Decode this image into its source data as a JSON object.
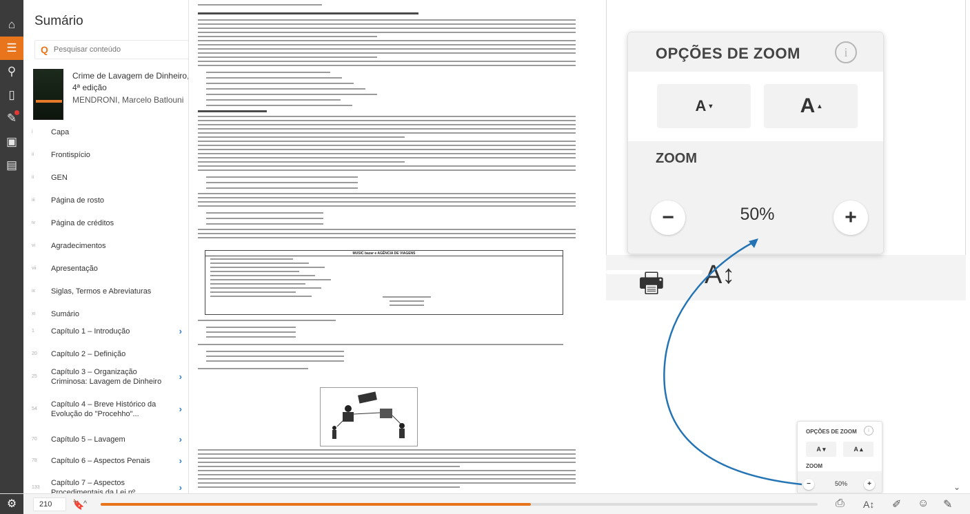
{
  "sidebar": {
    "title": "Sumário",
    "search_placeholder": "Pesquisar conteúdo",
    "book": {
      "title": "Crime de Lavagem de Dinheiro, 4ª edição",
      "author": "MENDRONI, Marcelo Batlouni"
    },
    "toc": [
      {
        "page": "i",
        "label": "Capa",
        "has_children": false
      },
      {
        "page": "ii",
        "label": "Frontispício",
        "has_children": false
      },
      {
        "page": "ii",
        "label": "GEN",
        "has_children": false
      },
      {
        "page": "iii",
        "label": "Página de rosto",
        "has_children": false
      },
      {
        "page": "iv",
        "label": "Página de créditos",
        "has_children": false
      },
      {
        "page": "vi",
        "label": "Agradecimentos",
        "has_children": false
      },
      {
        "page": "vii",
        "label": "Apresentação",
        "has_children": false
      },
      {
        "page": "ix",
        "label": "Siglas, Termos e Abreviaturas",
        "has_children": false
      },
      {
        "page": "xi",
        "label": "Sumário",
        "has_children": false
      },
      {
        "page": "1",
        "label": "Capítulo 1 – Introdução",
        "has_children": true
      },
      {
        "page": "20",
        "label": "Capítulo 2 – Definição",
        "has_children": false
      },
      {
        "page": "25",
        "label": "Capítulo 3 – Organização Criminosa: Lavagem de Dinheiro",
        "has_children": true
      },
      {
        "page": "54",
        "label": "Capítulo 4 – Breve Histórico da Evolução do \"Procehho\"...",
        "has_children": true
      },
      {
        "page": "70",
        "label": "Capítulo 5 – Lavagem",
        "has_children": true
      },
      {
        "page": "78",
        "label": "Capítulo 6 – Aspectos Penais",
        "has_children": true
      },
      {
        "page": "133",
        "label": "Capítulo 7 – Aspectos Procedimentais da Lei nº...",
        "has_children": true
      }
    ]
  },
  "document": {
    "heading": "13.5 TRANSFERÊNCIA DE DINHEIRO PARA O EXTERIOR POR \"DOLAR-CABO\" OU \"EURO-CABO\"",
    "subheading": "13.5.1 O Sistema Hawala",
    "table_title": "MUSIC bazar e AGÊNCIA DE VIAGENS"
  },
  "zoom_popover": {
    "title": "OPÇÕES DE ZOOM",
    "info_icon": "info-icon",
    "decrease_font_label": "A",
    "increase_font_label": "A",
    "zoom_label": "ZOOM",
    "zoom_value": "50%",
    "minus_label": "−",
    "plus_label": "+"
  },
  "bottombar": {
    "page_number": "210",
    "progress_fraction": 0.6,
    "accent_color": "#e8741c"
  },
  "colors": {
    "rail": "#3b3b3b",
    "accent": "#e8741c",
    "link": "#2c7bd6",
    "callout": "#2474b5"
  }
}
